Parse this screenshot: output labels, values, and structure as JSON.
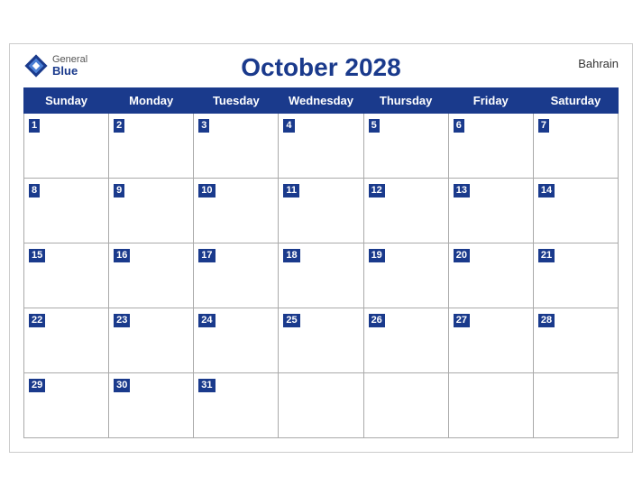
{
  "header": {
    "title": "October 2028",
    "country": "Bahrain",
    "logo_general": "General",
    "logo_blue": "Blue"
  },
  "days_of_week": [
    "Sunday",
    "Monday",
    "Tuesday",
    "Wednesday",
    "Thursday",
    "Friday",
    "Saturday"
  ],
  "weeks": [
    [
      {
        "date": "1",
        "empty": false
      },
      {
        "date": "2",
        "empty": false
      },
      {
        "date": "3",
        "empty": false
      },
      {
        "date": "4",
        "empty": false
      },
      {
        "date": "5",
        "empty": false
      },
      {
        "date": "6",
        "empty": false
      },
      {
        "date": "7",
        "empty": false
      }
    ],
    [
      {
        "date": "8",
        "empty": false
      },
      {
        "date": "9",
        "empty": false
      },
      {
        "date": "10",
        "empty": false
      },
      {
        "date": "11",
        "empty": false
      },
      {
        "date": "12",
        "empty": false
      },
      {
        "date": "13",
        "empty": false
      },
      {
        "date": "14",
        "empty": false
      }
    ],
    [
      {
        "date": "15",
        "empty": false
      },
      {
        "date": "16",
        "empty": false
      },
      {
        "date": "17",
        "empty": false
      },
      {
        "date": "18",
        "empty": false
      },
      {
        "date": "19",
        "empty": false
      },
      {
        "date": "20",
        "empty": false
      },
      {
        "date": "21",
        "empty": false
      }
    ],
    [
      {
        "date": "22",
        "empty": false
      },
      {
        "date": "23",
        "empty": false
      },
      {
        "date": "24",
        "empty": false
      },
      {
        "date": "25",
        "empty": false
      },
      {
        "date": "26",
        "empty": false
      },
      {
        "date": "27",
        "empty": false
      },
      {
        "date": "28",
        "empty": false
      }
    ],
    [
      {
        "date": "29",
        "empty": false
      },
      {
        "date": "30",
        "empty": false
      },
      {
        "date": "31",
        "empty": false
      },
      {
        "date": "",
        "empty": true
      },
      {
        "date": "",
        "empty": true
      },
      {
        "date": "",
        "empty": true
      },
      {
        "date": "",
        "empty": true
      }
    ]
  ],
  "colors": {
    "header_bg": "#1a3a8c",
    "header_text": "#ffffff",
    "title_color": "#1a3a8c"
  }
}
